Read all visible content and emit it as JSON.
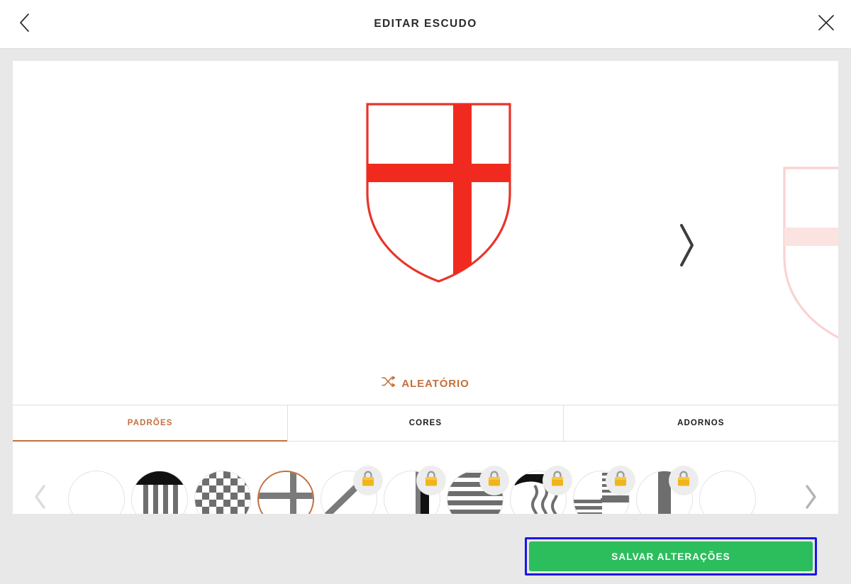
{
  "header": {
    "title": "EDITAR ESCUDO",
    "back_icon": "chevron-left-icon",
    "close_icon": "close-icon"
  },
  "preview": {
    "shield": {
      "name": "crest-preview",
      "pattern": "cross",
      "outline_color": "#e8342a",
      "field_color": "#ffffff",
      "charge_color": "#f12a1f"
    },
    "next_icon": "chevron-right-icon",
    "ghost_shield": {
      "name": "next-crest-ghost",
      "outline_color": "#f2c0bc",
      "band_color": "#fbd2d0"
    }
  },
  "random": {
    "label": "ALEATÓRIO",
    "icon": "shuffle-icon",
    "color": "#c2703e"
  },
  "tabs": [
    {
      "label": "PADRÕES",
      "active": true
    },
    {
      "label": "CORES",
      "active": false
    },
    {
      "label": "ADORNOS",
      "active": false
    }
  ],
  "carousel": {
    "prev_icon": "chevron-left-icon",
    "next_icon": "chevron-right-icon",
    "lock_icon": "padlock-icon",
    "accent_color": "#c2703e",
    "items": [
      {
        "name": "pattern-plain",
        "kind": "plain",
        "locked": false,
        "selected": false
      },
      {
        "name": "pattern-pales-chief",
        "kind": "pales-chief",
        "locked": false,
        "selected": false
      },
      {
        "name": "pattern-checky",
        "kind": "checky",
        "locked": false,
        "selected": false
      },
      {
        "name": "pattern-cross",
        "kind": "cross",
        "locked": false,
        "selected": true
      },
      {
        "name": "pattern-bend",
        "kind": "bend",
        "locked": true,
        "selected": false
      },
      {
        "name": "pattern-pale-right",
        "kind": "pale-right",
        "locked": true,
        "selected": false
      },
      {
        "name": "pattern-barry",
        "kind": "barry",
        "locked": true,
        "selected": false
      },
      {
        "name": "pattern-wavy-chief",
        "kind": "wavy-chief",
        "locked": true,
        "selected": false
      },
      {
        "name": "pattern-quarter-barry",
        "kind": "quarter-barry",
        "locked": true,
        "selected": false
      },
      {
        "name": "pattern-pale-thick",
        "kind": "pale-thick",
        "locked": true,
        "selected": false
      },
      {
        "name": "pattern-partial",
        "kind": "plain",
        "locked": false,
        "selected": false
      }
    ]
  },
  "footer": {
    "save_label": "SALVAR ALTERAÇÕES",
    "save_color": "#2cbe5d",
    "focus_outline_color": "#1a16e8"
  }
}
